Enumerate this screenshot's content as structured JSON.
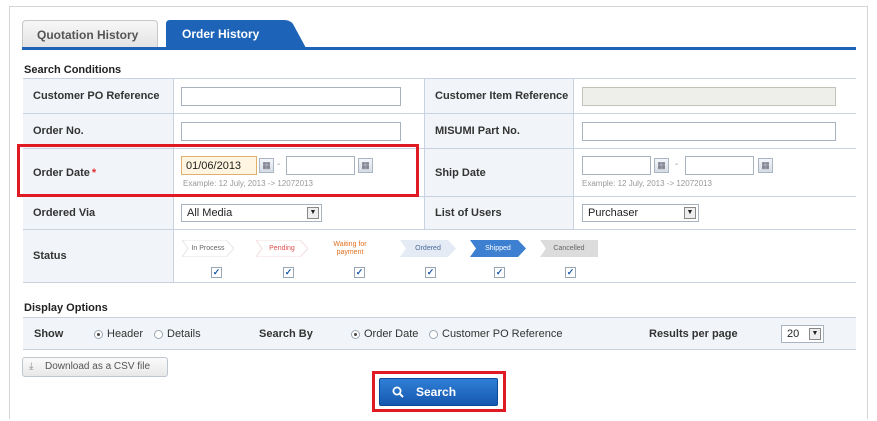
{
  "tabs": [
    {
      "label": "Quotation History",
      "active": false
    },
    {
      "label": "Order History",
      "active": true
    }
  ],
  "search_conditions": {
    "title": "Search Conditions",
    "customer_po_reference": {
      "label": "Customer PO Reference",
      "value": ""
    },
    "customer_item_reference": {
      "label": "Customer Item Reference",
      "value": "",
      "disabled": true
    },
    "order_no": {
      "label": "Order No.",
      "value": ""
    },
    "misumi_part_no": {
      "label": "MISUMI Part No.",
      "value": ""
    },
    "order_date": {
      "label": "Order Date",
      "required_mark": "*",
      "from": "01/06/2013",
      "to": "",
      "separator": "-",
      "example": "Example: 12 July, 2013 -> 12072013"
    },
    "ship_date": {
      "label": "Ship Date",
      "from": "",
      "to": "",
      "separator": "-",
      "example": "Example: 12 July, 2013 -> 12072013"
    },
    "ordered_via": {
      "label": "Ordered Via",
      "selected": "All Media"
    },
    "list_of_users": {
      "label": "List of Users",
      "selected": "Purchaser"
    },
    "status": {
      "label": "Status",
      "items": [
        {
          "label": "In Process",
          "checked": true,
          "color": "#ffffff",
          "text_color": "#666666"
        },
        {
          "label": "Pending",
          "checked": true,
          "color": "#ffffff",
          "text_color": "#e05050"
        },
        {
          "label": "Waiting for\npayment",
          "checked": true,
          "color": "#ffffff",
          "text_color": "#e07020"
        },
        {
          "label": "Ordered",
          "checked": true,
          "color": "#e4ebf5",
          "text_color": "#4a6a9a"
        },
        {
          "label": "Shipped",
          "checked": true,
          "color": "#3d7fd0",
          "text_color": "#ffffff"
        },
        {
          "label": "Cancelled",
          "checked": true,
          "color": "#dcdcdc",
          "text_color": "#666666"
        }
      ]
    }
  },
  "display_options": {
    "title": "Display Options",
    "show_label": "Show",
    "show_options": [
      {
        "label": "Header",
        "selected": true
      },
      {
        "label": "Details",
        "selected": false
      }
    ],
    "search_by_label": "Search By",
    "search_by_options": [
      {
        "label": "Order Date",
        "selected": true
      },
      {
        "label": "Customer PO Reference",
        "selected": false
      }
    ],
    "results_per_page_label": "Results per page",
    "results_per_page": "20"
  },
  "actions": {
    "csv_label": "Download as a CSV file",
    "search_label": "Search"
  },
  "colors": {
    "accent": "#1d63b8",
    "highlight": "#e01a22"
  }
}
